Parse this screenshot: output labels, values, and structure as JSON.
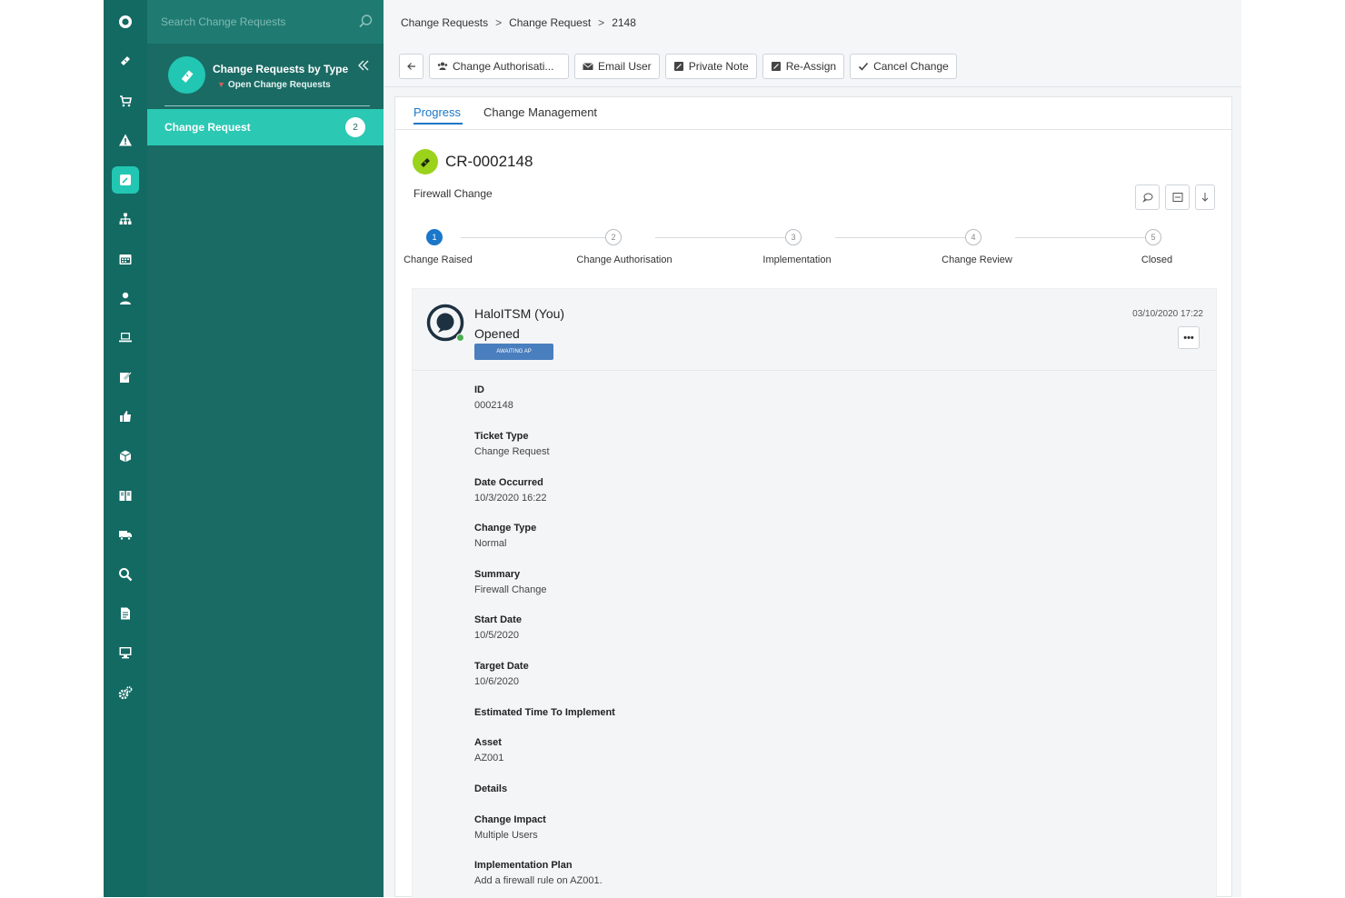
{
  "sidebar": {
    "search_placeholder": "Search Change Requests",
    "filter_title": "Change Requests by Type",
    "filter_subtitle": "Open Change Requests",
    "nav_item_label": "Change Request",
    "nav_item_count": "2"
  },
  "breadcrumb": [
    "Change Requests",
    "Change Request",
    "2148"
  ],
  "toolbar": {
    "authorisation": "Change Authorisati...",
    "email_user": "Email User",
    "private_note": "Private Note",
    "reassign": "Re-Assign",
    "cancel_change": "Cancel Change"
  },
  "tabs": [
    "Progress",
    "Change Management"
  ],
  "ticket": {
    "id": "CR-0002148",
    "summary": "Firewall Change"
  },
  "steps": [
    {
      "number": "1",
      "label": "Change Raised",
      "active": true
    },
    {
      "number": "2",
      "label": "Change Authorisation",
      "active": false
    },
    {
      "number": "3",
      "label": "Implementation",
      "active": false
    },
    {
      "number": "4",
      "label": "Change Review",
      "active": false
    },
    {
      "number": "5",
      "label": "Closed",
      "active": false
    }
  ],
  "action": {
    "author": "HaloITSM (You)",
    "type": "Opened",
    "status_badge": "AWAITING AP",
    "timestamp": "03/10/2020 17:22",
    "more": "•••"
  },
  "fields": [
    {
      "label": "ID",
      "value": "0002148"
    },
    {
      "label": "Ticket Type",
      "value": "Change Request"
    },
    {
      "label": "Date Occurred",
      "value": "10/3/2020 16:22"
    },
    {
      "label": "Change Type",
      "value": "Normal"
    },
    {
      "label": "Summary",
      "value": "Firewall Change"
    },
    {
      "label": "Start Date",
      "value": "10/5/2020"
    },
    {
      "label": "Target Date",
      "value": "10/6/2020"
    },
    {
      "label": "Estimated Time To Implement",
      "value": ""
    },
    {
      "label": "Asset",
      "value": "AZ001"
    },
    {
      "label": "Details",
      "value": ""
    },
    {
      "label": "Change Impact",
      "value": "Multiple Users"
    },
    {
      "label": "Implementation Plan",
      "value": "Add a firewall rule on AZ001."
    }
  ],
  "colors": {
    "rail": "#126a62",
    "sidebar": "#1a6b64",
    "accent": "#2bc8b4",
    "link_blue": "#1a77c9",
    "ticket_icon": "#9bd21b"
  }
}
